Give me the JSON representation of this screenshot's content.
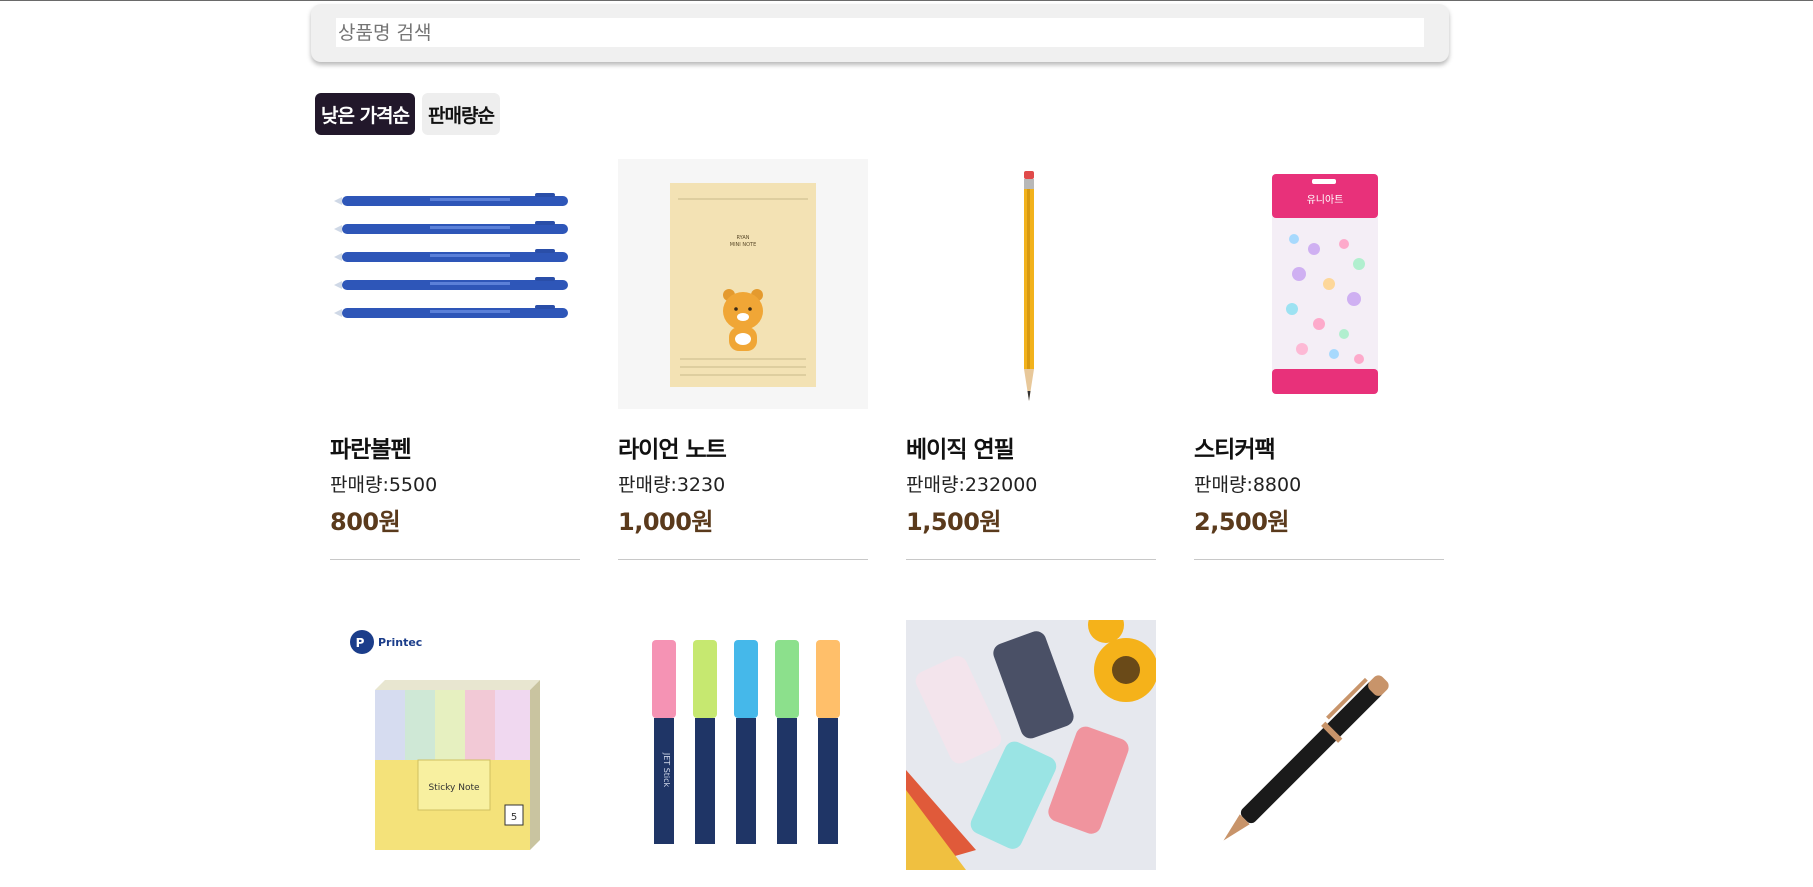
{
  "search": {
    "placeholder": "상품명 검색",
    "value": ""
  },
  "sort": {
    "options": [
      {
        "label": "낮은 가격순",
        "active": true
      },
      {
        "label": "판매량순",
        "active": false
      }
    ]
  },
  "sales_prefix": "판매량:",
  "products": [
    {
      "name": "파란볼펜",
      "sales": "5500",
      "price": "800원",
      "image": "blue-ballpoint-pens-image"
    },
    {
      "name": "라이언 노트",
      "sales": "3230",
      "price": "1,000원",
      "image": "ryan-notebook-image",
      "image_text": [
        "RYAN",
        "MINI NOTE"
      ]
    },
    {
      "name": "베이직 연필",
      "sales": "232000",
      "price": "1,500원",
      "image": "yellow-pencil-image"
    },
    {
      "name": "스티커팩",
      "sales": "8800",
      "price": "2,500원",
      "image": "sticker-pack-image",
      "image_text": [
        "유니아트"
      ]
    },
    {
      "name": "",
      "image": "sticky-note-cube-image",
      "image_text": [
        "Printec",
        "Sticky Note",
        "5"
      ]
    },
    {
      "name": "",
      "image": "pastel-markers-image",
      "image_text": [
        "JET Stick"
      ]
    },
    {
      "name": "",
      "image": "phone-cases-image"
    },
    {
      "name": "",
      "image": "fountain-pen-image"
    }
  ],
  "colors": {
    "active_sort_bg": "#22182b",
    "price": "#5a3a1c",
    "search_bg": "#f0f0f0"
  }
}
